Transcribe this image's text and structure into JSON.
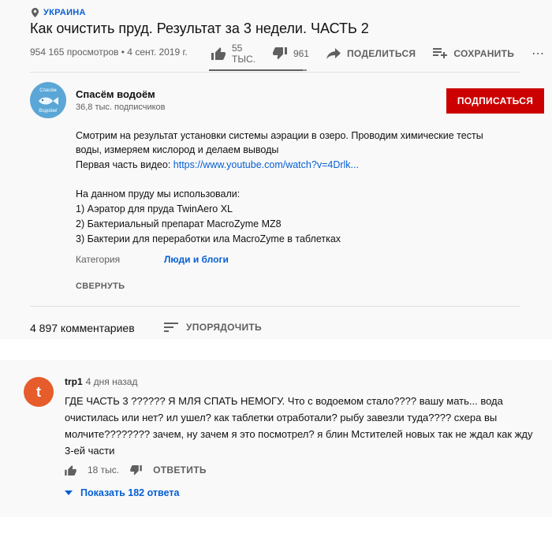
{
  "video": {
    "location": "УКРАИНА",
    "title": "Как очистить пруд. Результат за 3 недели. ЧАСТЬ 2",
    "meta": "954 165 просмотров • 4 сент. 2019 г.",
    "likes": "55 ТЫС.",
    "dislikes": "961",
    "share_label": "ПОДЕЛИТЬСЯ",
    "save_label": "СОХРАНИТЬ",
    "more_label": "⋯",
    "like_ratio": 0.96
  },
  "channel": {
    "name": "Спасём водоём",
    "subscribers": "36,8 тыс. подписчиков",
    "subscribe_label": "ПОДПИСАТЬСЯ",
    "avatar_text_top": "Спасём",
    "avatar_text_bottom": "Водоём!"
  },
  "description": {
    "line1": "Смотрим на результат установки системы аэрации в озеро. Проводим химические тесты",
    "line2": "воды, измеряем кислород и делаем выводы",
    "link_prefix": "Первая часть видео: ",
    "link_text": "https://www.youtube.com/watch?v=4Drlk...",
    "list_title": "На данном пруду мы использовали:",
    "item1": "1) Аэратор для пруда TwinAero XL",
    "item2": "2) Бактериальный препарат MacroZyme MZ8",
    "item3": "3) Бактерии для переработки ила MacroZyme в таблетках",
    "category_label": "Категория",
    "category_value": "Люди и блоги",
    "collapse_label": "СВЕРНУТЬ"
  },
  "comments": {
    "count_label": "4 897 комментариев",
    "sort_label": "УПОРЯДОЧИТЬ"
  },
  "comment": {
    "avatar_letter": "t",
    "author": "trp1",
    "time": "4 дня назад",
    "text": "ГДЕ ЧАСТЬ 3 ?????? Я МЛЯ СПАТЬ НЕМОГУ. Что с водоемом стало???? вашу мать... вода очистилась или нет? ил ушел? как таблетки отработали? рыбу завезли туда???? схера вы молчите???????? зачем, ну зачем я это посмотрел? я блин Мстителей новых так не ждал как жду 3-ей части",
    "likes": "18 тыс.",
    "reply_label": "ОТВЕТИТЬ",
    "show_replies": "Показать 182 ответа"
  }
}
